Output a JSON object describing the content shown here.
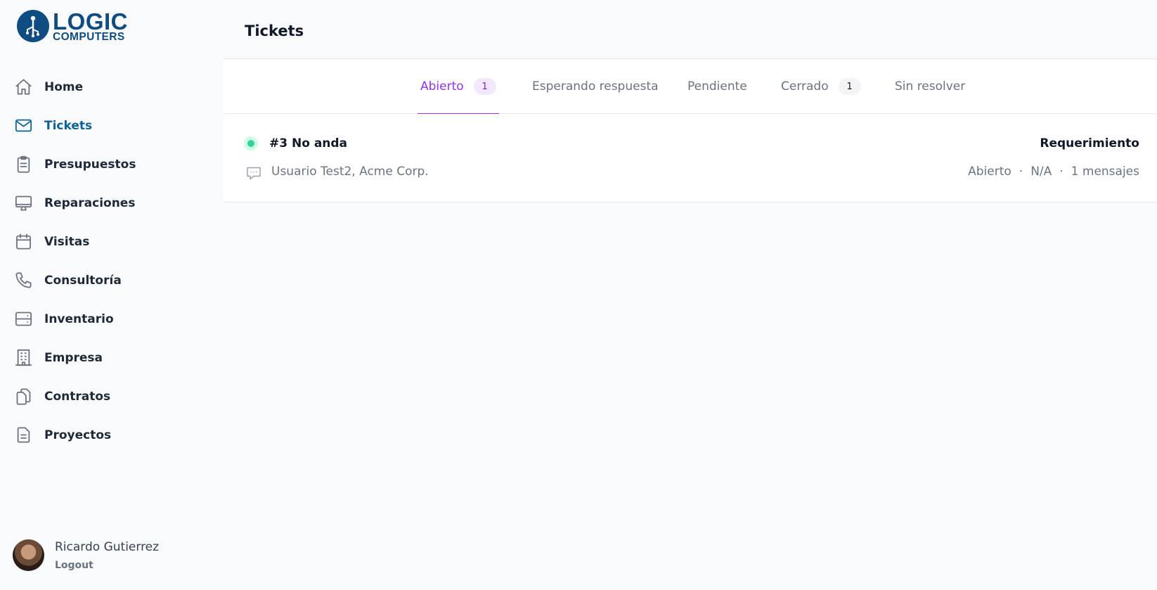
{
  "brand": {
    "line1": "LOGIC",
    "line2": "COMPUTERS"
  },
  "sidebar": {
    "items": [
      {
        "label": "Home",
        "icon": "home-icon"
      },
      {
        "label": "Tickets",
        "icon": "mail-icon",
        "active": true
      },
      {
        "label": "Presupuestos",
        "icon": "clipboard-icon"
      },
      {
        "label": "Reparaciones",
        "icon": "desktop-icon"
      },
      {
        "label": "Visitas",
        "icon": "calendar-icon"
      },
      {
        "label": "Consultoría",
        "icon": "phone-icon"
      },
      {
        "label": "Inventario",
        "icon": "server-icon"
      },
      {
        "label": "Empresa",
        "icon": "building-icon"
      },
      {
        "label": "Contratos",
        "icon": "documents-icon"
      },
      {
        "label": "Proyectos",
        "icon": "document-icon"
      }
    ]
  },
  "user": {
    "name": "Ricardo Gutierrez",
    "logout_label": "Logout"
  },
  "header": {
    "title": "Tickets"
  },
  "tabs": [
    {
      "label": "Abierto",
      "count": "1",
      "active": true
    },
    {
      "label": "Esperando respuesta"
    },
    {
      "label": "Pendiente"
    },
    {
      "label": "Cerrado",
      "count": "1"
    },
    {
      "label": "Sin resolver"
    }
  ],
  "tickets": [
    {
      "title": "#3 No anda",
      "type": "Requerimiento",
      "client": "Usuario Test2, Acme Corp.",
      "status": "Abierto",
      "assignee": "N/A",
      "messages": "1 mensajes",
      "separator": "·"
    }
  ],
  "colors": {
    "brand": "#0f4c81",
    "active_nav": "#0e6396",
    "active_tab": "#9333ea",
    "status_open": "#34d399"
  }
}
